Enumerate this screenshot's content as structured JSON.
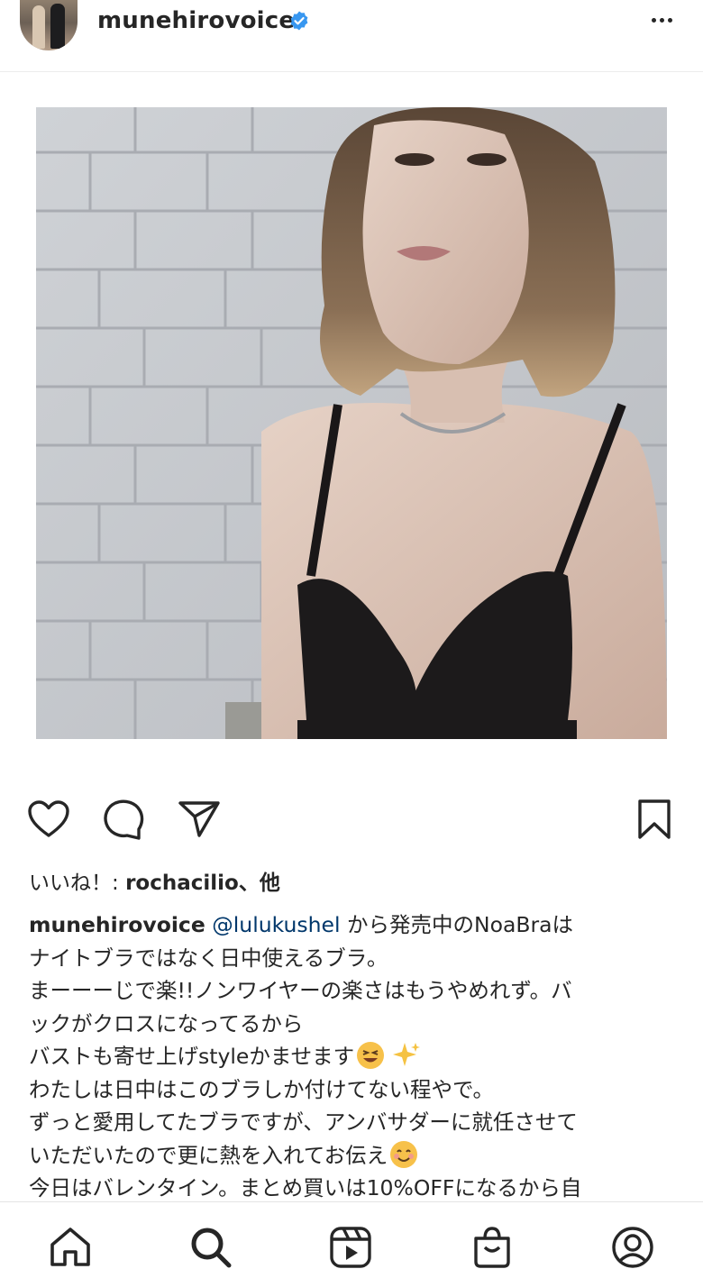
{
  "header": {
    "username": "munehirovoice",
    "verified_color": "#3897f0"
  },
  "post": {
    "likes_prefix": "いいね！: ",
    "likes_user": "rochacilio",
    "likes_suffix": "、他",
    "caption_username": "munehirovoice",
    "caption_mention": "@lulukushel",
    "caption_lines": [
      " から発売中のNoaBraは",
      "ナイトブラではなく日中使えるブラ。",
      "まーーーじで楽!!ノンワイヤーの楽さはもうやめれず。バ",
      "ックがクロスになってるから",
      "バストも寄せ上げstyleかませます",
      "わたしは日中はこのブラしか付けてない程やで。",
      "ずっと愛用してたブラですが、アンバサダーに就任させて",
      "いただいたので更に熱を入れてお伝え",
      "今日はバレンタイン。まとめ買いは10%OFFになるから自"
    ]
  },
  "icons": {
    "like": "heart-icon",
    "comment": "comment-icon",
    "share": "paper-plane-icon",
    "save": "bookmark-icon",
    "nav": [
      "home-icon",
      "search-icon",
      "reels-icon",
      "shop-icon",
      "profile-icon"
    ]
  }
}
